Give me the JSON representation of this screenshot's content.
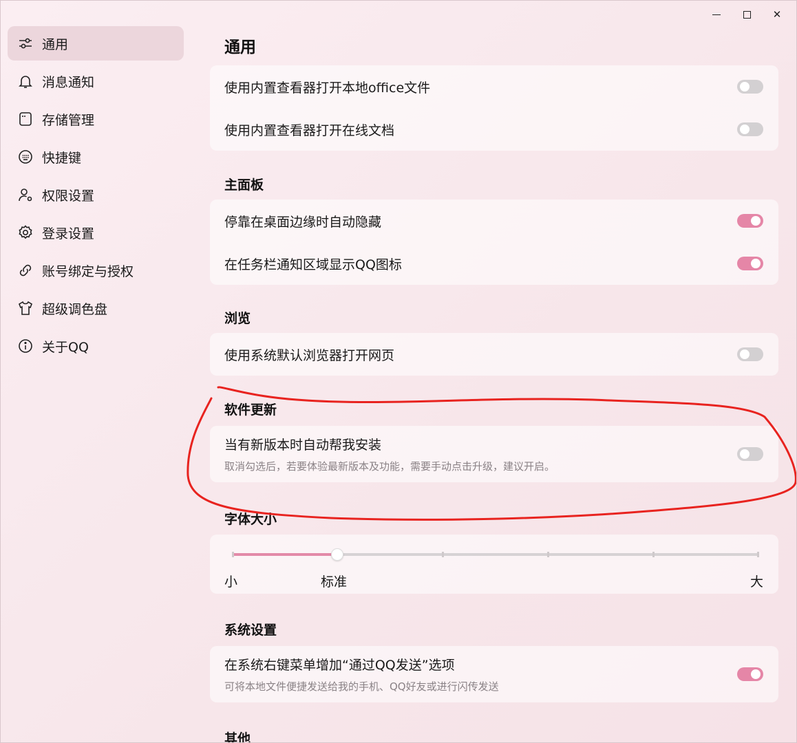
{
  "window": {
    "minimize": "—",
    "close": "✕"
  },
  "sidebar": {
    "items": [
      {
        "label": "通用",
        "icon": "sliders-icon"
      },
      {
        "label": "消息通知",
        "icon": "bell-icon"
      },
      {
        "label": "存储管理",
        "icon": "storage-icon"
      },
      {
        "label": "快捷键",
        "icon": "keyboard-icon"
      },
      {
        "label": "权限设置",
        "icon": "user-gear-icon"
      },
      {
        "label": "登录设置",
        "icon": "gear-icon"
      },
      {
        "label": "账号绑定与授权",
        "icon": "link-icon"
      },
      {
        "label": "超级调色盘",
        "icon": "tshirt-icon"
      },
      {
        "label": "关于QQ",
        "icon": "info-icon"
      }
    ]
  },
  "main": {
    "title": "通用",
    "office": {
      "rows": [
        {
          "label": "使用内置查看器打开本地office文件",
          "on": false
        },
        {
          "label": "使用内置查看器打开在线文档",
          "on": false
        }
      ]
    },
    "panel": {
      "title": "主面板",
      "rows": [
        {
          "label": "停靠在桌面边缘时自动隐藏",
          "on": true
        },
        {
          "label": "在任务栏通知区域显示QQ图标",
          "on": true
        }
      ]
    },
    "browse": {
      "title": "浏览",
      "rows": [
        {
          "label": "使用系统默认浏览器打开网页",
          "on": false
        }
      ]
    },
    "update": {
      "title": "软件更新",
      "row": {
        "label": "当有新版本时自动帮我安装",
        "sub": "取消勾选后，若要体验最新版本及功能，需要手动点击升级，建议开启。",
        "on": false
      }
    },
    "font": {
      "title": "字体大小",
      "labels": {
        "small": "小",
        "standard": "标准",
        "large": "大"
      },
      "level_fraction": 0.2
    },
    "system": {
      "title": "系统设置",
      "row": {
        "label": "在系统右键菜单增加“通过QQ发送”选项",
        "sub": "可将本地文件便捷发送给我的手机、QQ好友或进行闪传发送",
        "on": true
      }
    },
    "other": {
      "title": "其他"
    }
  },
  "colors": {
    "accent": "#e586a7",
    "annotation": "#e8231f"
  }
}
